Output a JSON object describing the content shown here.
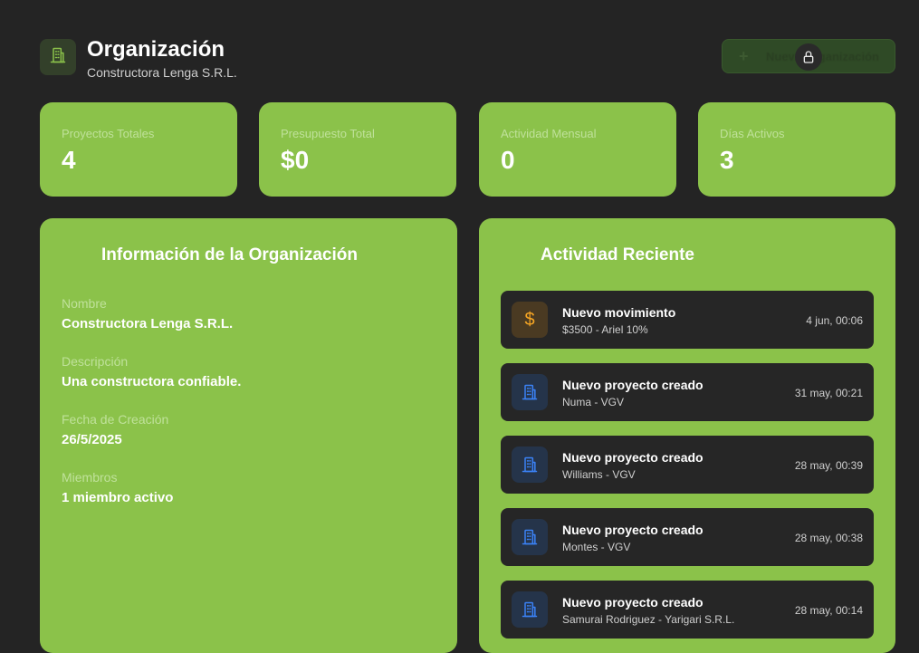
{
  "header": {
    "title": "Organización",
    "subtitle": "Constructora Lenga S.R.L.",
    "new_button_label": "Nueva Organización"
  },
  "stats": [
    {
      "label": "Proyectos Totales",
      "value": "4"
    },
    {
      "label": "Presupuesto Total",
      "value": "$0"
    },
    {
      "label": "Actividad Mensual",
      "value": "0"
    },
    {
      "label": "Días Activos",
      "value": "3"
    }
  ],
  "info": {
    "title": "Información de la Organización",
    "fields": [
      {
        "label": "Nombre",
        "value": "Constructora Lenga S.R.L."
      },
      {
        "label": "Descripción",
        "value": "Una constructora confiable."
      },
      {
        "label": "Fecha de Creación",
        "value": "26/5/2025"
      },
      {
        "label": "Miembros",
        "value": "1 miembro activo"
      }
    ]
  },
  "activity": {
    "title": "Actividad Reciente",
    "items": [
      {
        "icon": "dollar-icon",
        "title": "Nuevo movimiento",
        "subtitle": "$3500 - Ariel 10%",
        "time": "4 jun, 00:06"
      },
      {
        "icon": "building-icon",
        "title": "Nuevo proyecto creado",
        "subtitle": "Numa - VGV",
        "time": "31 may, 00:21"
      },
      {
        "icon": "building-icon",
        "title": "Nuevo proyecto creado",
        "subtitle": "Williams - VGV",
        "time": "28 may, 00:39"
      },
      {
        "icon": "building-icon",
        "title": "Nuevo proyecto creado",
        "subtitle": "Montes - VGV",
        "time": "28 may, 00:38"
      },
      {
        "icon": "building-icon",
        "title": "Nuevo proyecto creado",
        "subtitle": "Samurai Rodriguez - Yarigari S.R.L.",
        "time": "28 may, 00:14"
      }
    ]
  },
  "colors": {
    "background": "#242424",
    "accent": "#8bc24a",
    "card_dark": "#262626",
    "money_icon": "#f5a524",
    "project_icon": "#3b82f6"
  }
}
